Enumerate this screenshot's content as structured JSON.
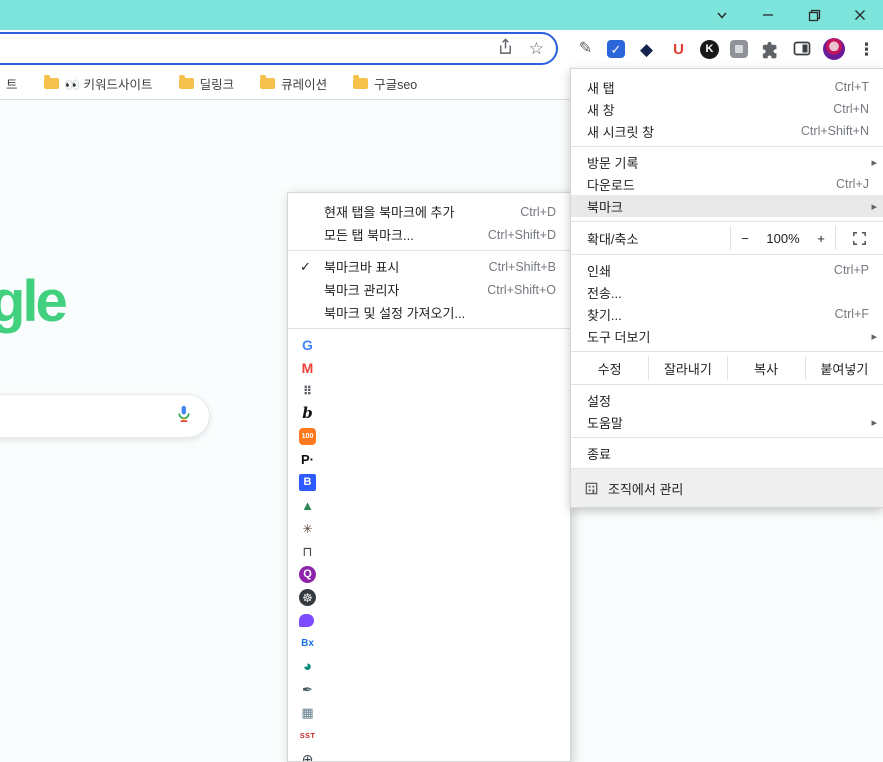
{
  "icons": {
    "star": "☆",
    "kebab": "⋮",
    "pencil_ext": "✎",
    "check_ext": "✓",
    "shield_ext": "◆",
    "u_ext": "U",
    "k_ext": "K",
    "submenu_arrow": "▸",
    "checkmark": "✓"
  },
  "bookmarks_bar": {
    "items": [
      {
        "label": "트"
      },
      {
        "label": "👀 키워드사이트"
      },
      {
        "label": "딜링크"
      },
      {
        "label": "큐레이션"
      },
      {
        "label": "구글seo"
      }
    ]
  },
  "page": {
    "logo_text": "gle"
  },
  "menu": {
    "new_tab": {
      "label": "새 탭",
      "shortcut": "Ctrl+T"
    },
    "new_window": {
      "label": "새 창",
      "shortcut": "Ctrl+N"
    },
    "new_incognito": {
      "label": "새 시크릿 창",
      "shortcut": "Ctrl+Shift+N"
    },
    "history": {
      "label": "방문 기록"
    },
    "downloads": {
      "label": "다운로드",
      "shortcut": "Ctrl+J"
    },
    "bookmarks": {
      "label": "북마크"
    },
    "zoom": {
      "label": "확대/축소",
      "minus": "−",
      "value": "100%",
      "plus": "+"
    },
    "print": {
      "label": "인쇄",
      "shortcut": "Ctrl+P"
    },
    "cast": {
      "label": "전송..."
    },
    "find": {
      "label": "찾기...",
      "shortcut": "Ctrl+F"
    },
    "more_tools": {
      "label": "도구 더보기"
    },
    "edit": {
      "edit": "수정",
      "cut": "잘라내기",
      "copy": "복사",
      "paste": "붙여넣기"
    },
    "settings": {
      "label": "설정"
    },
    "help": {
      "label": "도움말"
    },
    "exit": {
      "label": "종료"
    },
    "managed": {
      "label": "조직에서 관리"
    }
  },
  "bookmark_menu": {
    "add_current": {
      "label": "현재 탭을 북마크에 추가",
      "shortcut": "Ctrl+D"
    },
    "add_all": {
      "label": "모든 탭 북마크...",
      "shortcut": "Ctrl+Shift+D"
    },
    "show_bar": {
      "label": "북마크바 표시",
      "shortcut": "Ctrl+Shift+B"
    },
    "manager": {
      "label": "북마크 관리자",
      "shortcut": "Ctrl+Shift+O"
    },
    "import": {
      "label": "북마크 및 설정 가져오기..."
    },
    "favicons": [
      {
        "name": "google",
        "glyph": "G"
      },
      {
        "name": "gmail",
        "glyph": "M"
      },
      {
        "name": "dots",
        "glyph": "⠿"
      },
      {
        "name": "script-b",
        "glyph": "b"
      },
      {
        "name": "hundred-badge",
        "glyph": "100"
      },
      {
        "name": "p-dot",
        "glyph": "P·"
      },
      {
        "name": "b-square",
        "glyph": "B"
      },
      {
        "name": "tree",
        "glyph": "▲"
      },
      {
        "name": "ant",
        "glyph": "✳"
      },
      {
        "name": "tshirt",
        "glyph": "⊓"
      },
      {
        "name": "q-circle",
        "glyph": "Q"
      },
      {
        "name": "wheel",
        "glyph": "☸"
      },
      {
        "name": "chat-bubble",
        "glyph": ""
      },
      {
        "name": "b-x",
        "glyph": "Bx"
      },
      {
        "name": "pie",
        "glyph": "◕"
      },
      {
        "name": "quill",
        "glyph": "✒"
      },
      {
        "name": "pixel-image",
        "glyph": "▦"
      },
      {
        "name": "sst",
        "glyph": "SST"
      },
      {
        "name": "globe",
        "glyph": "⊕"
      }
    ]
  }
}
